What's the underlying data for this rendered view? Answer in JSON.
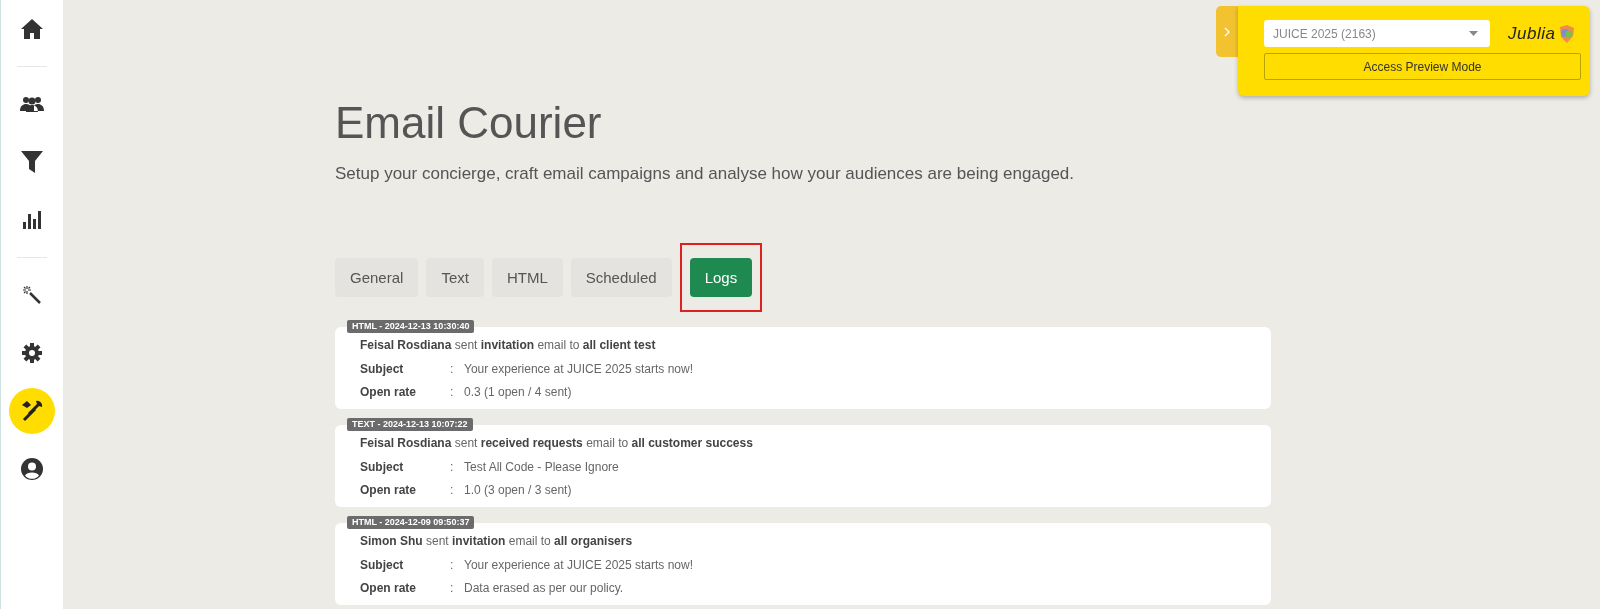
{
  "sidebar": {
    "groups": [
      [
        {
          "kind": "home",
          "selected": false
        }
      ],
      [
        {
          "kind": "people",
          "selected": false
        },
        {
          "kind": "filter",
          "selected": false
        },
        {
          "kind": "chart",
          "selected": false
        }
      ],
      [
        {
          "kind": "wand",
          "selected": false
        },
        {
          "kind": "gear",
          "selected": false
        },
        {
          "kind": "tools",
          "selected": true
        },
        {
          "kind": "user",
          "selected": false
        }
      ]
    ]
  },
  "header": {
    "title": "Email Courier",
    "subtitle": "Setup your concierge, craft email campaigns and analyse how your audiences are being engaged."
  },
  "tabs": [
    {
      "label": "General",
      "selected": false,
      "highlighted": false
    },
    {
      "label": "Text",
      "selected": false,
      "highlighted": false
    },
    {
      "label": "HTML",
      "selected": false,
      "highlighted": false
    },
    {
      "label": "Scheduled",
      "selected": false,
      "highlighted": false
    },
    {
      "label": "Logs",
      "selected": true,
      "highlighted": true
    }
  ],
  "logs": [
    {
      "badge": "HTML - 2024-12-13 10:30:40",
      "summary": "**Feisal Rosdiana** sent **invitation** email to **all client test**",
      "fields": [
        {
          "label": "Subject",
          "separator": ":",
          "value": "Your experience at JUICE 2025 starts now!"
        },
        {
          "label": "Open rate",
          "separator": ":",
          "value": "0.3 (1 open / 4 sent)"
        }
      ]
    },
    {
      "badge": "TEXT - 2024-12-13 10:07:22",
      "summary": "**Feisal Rosdiana** sent **received requests** email to **all customer success**",
      "fields": [
        {
          "label": "Subject",
          "separator": ":",
          "value": "Test All Code - Please Ignore"
        },
        {
          "label": "Open rate",
          "separator": ":",
          "value": "1.0 (3 open / 3 sent)"
        }
      ]
    },
    {
      "badge": "HTML - 2024-12-09 09:50:37",
      "summary": "**Simon Shu** sent **invitation** email to **all organisers**",
      "fields": [
        {
          "label": "Subject",
          "separator": ":",
          "value": "Your experience at JUICE 2025 starts now!"
        },
        {
          "label": "Open rate",
          "separator": ":",
          "value": "Data erased as per our policy."
        }
      ]
    }
  ],
  "preview_panel": {
    "event_select": {
      "value": "JUICE 2025 (2163)"
    },
    "logo": "Jublia",
    "button": "Access Preview Mode"
  }
}
